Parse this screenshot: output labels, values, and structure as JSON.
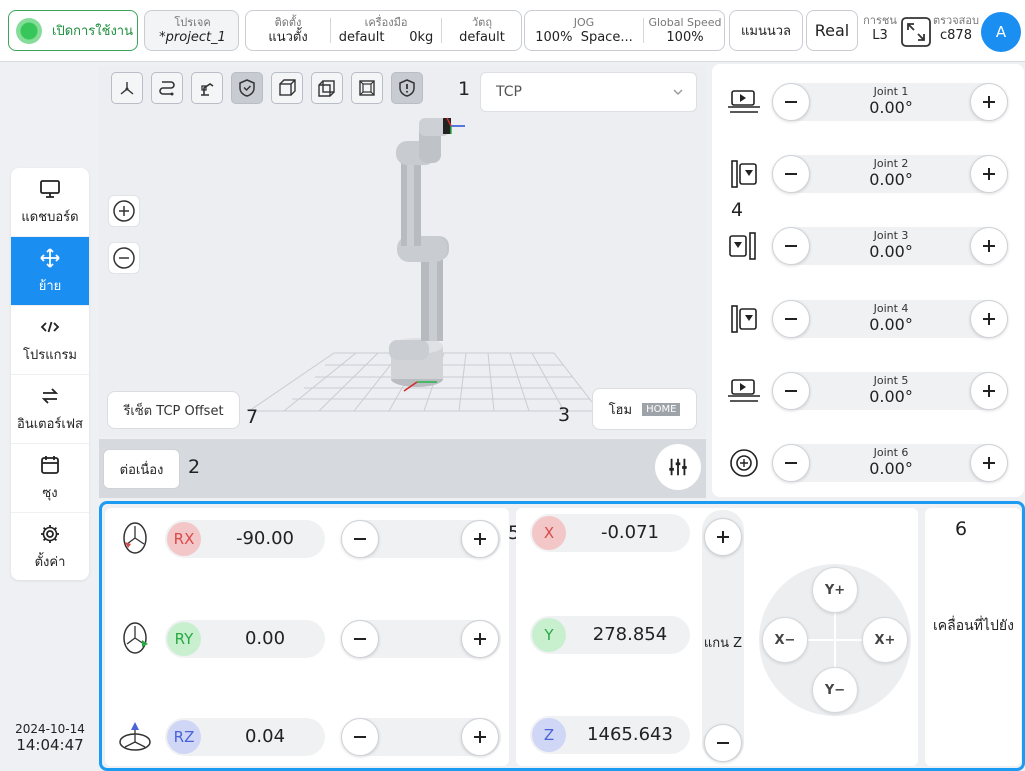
{
  "topbar": {
    "power_label": "เปิดการใช้งาน",
    "project_caption": "โปรเจค",
    "project_name": "*project_1",
    "install_caption": "ติดตั้ง",
    "install_value": "แนวตั้ง",
    "tool_caption": "เครื่องมือ",
    "tool_value": "default",
    "tool_weight": "0kg",
    "object_caption": "วัตถุ",
    "object_value": "default",
    "jog_caption": "JOG",
    "jog_value": "100%",
    "jog_mode": "Space...",
    "global_speed_caption": "Global Speed",
    "global_speed_value": "100%",
    "manual_label": "แมนนวล",
    "real_label": "Real",
    "collision_caption": "การชน",
    "collision_value": "L3",
    "check_caption": "ตรวจสอบ",
    "check_value": "c878",
    "avatar_letter": "A"
  },
  "sidebar": {
    "items": [
      {
        "label": "แดชบอร์ด",
        "icon": "monitor-icon"
      },
      {
        "label": "ย้าย",
        "icon": "move-arrows-icon"
      },
      {
        "label": "โปรแกรม",
        "icon": "code-icon"
      },
      {
        "label": "อินเตอร์เฟส",
        "icon": "swap-arrows-icon"
      },
      {
        "label": "ซุง",
        "icon": "calendar-icon"
      },
      {
        "label": "ตั้งค่า",
        "icon": "gear-icon"
      }
    ],
    "active_index": 1,
    "date": "2024-10-14",
    "time": "14:04:47"
  },
  "viewport": {
    "tcp_select_value": "TCP",
    "reset_tcp_label": "รีเซ็ต TCP Offset",
    "home_label": "โฮม",
    "home_tag": "HOME",
    "continuous_label": "ต่อเนื่อง",
    "callouts": {
      "c1": "1",
      "c2": "2",
      "c3": "3",
      "c7": "7"
    }
  },
  "joints": {
    "callout": "4",
    "items": [
      {
        "name": "Joint 1",
        "value": "0.00°"
      },
      {
        "name": "Joint 2",
        "value": "0.00°"
      },
      {
        "name": "Joint 3",
        "value": "0.00°"
      },
      {
        "name": "Joint 4",
        "value": "0.00°"
      },
      {
        "name": "Joint 5",
        "value": "0.00°"
      },
      {
        "name": "Joint 6",
        "value": "0.00°"
      }
    ]
  },
  "rotation": {
    "callout": "5",
    "rows": [
      {
        "axis": "RX",
        "value": "-90.00",
        "color": "#f3c7c7",
        "text": "#d84a4a"
      },
      {
        "axis": "RY",
        "value": "0.00",
        "color": "#c8f0cf",
        "text": "#29a845"
      },
      {
        "axis": "RZ",
        "value": "0.04",
        "color": "#cfd6f6",
        "text": "#4a63d6"
      }
    ]
  },
  "position": {
    "rows": [
      {
        "axis": "X",
        "value": "-0.071",
        "color": "#f3c7c7",
        "text": "#d84a4a"
      },
      {
        "axis": "Y",
        "value": "278.854",
        "color": "#c8f0cf",
        "text": "#29a845"
      },
      {
        "axis": "Z",
        "value": "1465.643",
        "color": "#cfd6f6",
        "text": "#4a63d6"
      }
    ],
    "z_label": "แกน Z",
    "pad": {
      "up": "Y+",
      "down": "Y−",
      "left": "X−",
      "right": "X+"
    }
  },
  "move_to": {
    "callout": "6",
    "label": "เคลื่อนที่ไปยัง"
  }
}
